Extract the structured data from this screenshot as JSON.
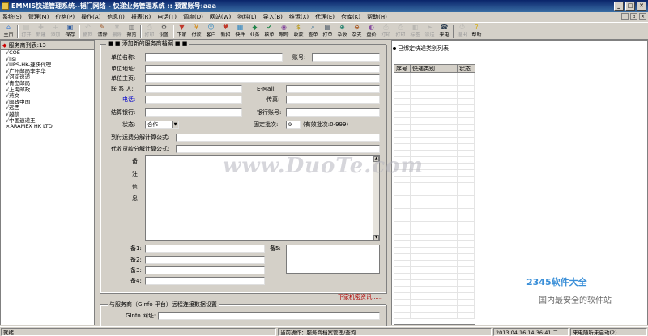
{
  "window": {
    "title": "EMMIS快递管理系统--韬门网络 - 快递业务管理系统 :: 预置账号:aaa",
    "buttons": [
      "_",
      "□",
      "✕"
    ]
  },
  "menu": [
    "系统(S)",
    "管理(M)",
    "价格(P)",
    "操作(A)",
    "信息(I)",
    "报表(R)",
    "电话(T)",
    "调度(D)",
    "网站(W)",
    "物料(L)",
    "导入(B)",
    "维运(X)",
    "代理(E)",
    "仓库(K)",
    "帮助(H)"
  ],
  "toolbar": [
    {
      "label": "主页",
      "icon": "home-icon",
      "glyph": "⌂",
      "color": "#3a7bd5",
      "enabled": true
    },
    {
      "label": "打开",
      "icon": "open-icon",
      "glyph": "▤",
      "color": "#999999",
      "enabled": false
    },
    {
      "label": "新建",
      "icon": "new-icon",
      "glyph": "✚",
      "color": "#999999",
      "enabled": false
    },
    {
      "label": "添加",
      "icon": "add-icon",
      "glyph": "+",
      "color": "#999999",
      "enabled": false
    },
    {
      "label": "保存",
      "icon": "save-icon",
      "glyph": "▣",
      "color": "#2c5aa0",
      "enabled": true
    },
    {
      "label": "撤回",
      "icon": "undo-icon",
      "glyph": "↶",
      "color": "#999999",
      "enabled": false
    },
    {
      "label": "清除",
      "icon": "clear-icon",
      "glyph": "✎",
      "color": "#a05a2c",
      "enabled": true
    },
    {
      "label": "删除",
      "icon": "delete-icon",
      "glyph": "✖",
      "color": "#999999",
      "enabled": false
    },
    {
      "label": "预览",
      "icon": "preview-icon",
      "glyph": "▥",
      "color": "#777777",
      "enabled": true
    },
    {
      "label": "打印",
      "icon": "print-icon",
      "glyph": "⎙",
      "color": "#999999",
      "enabled": false
    },
    {
      "label": "设置",
      "icon": "settings-icon",
      "glyph": "⚙",
      "color": "#555555",
      "enabled": true
    },
    {
      "label": "下家",
      "icon": "downline-icon",
      "glyph": "▼",
      "color": "#c0392b",
      "enabled": true
    },
    {
      "label": "付款",
      "icon": "payment-icon",
      "glyph": "¥",
      "color": "#d68910",
      "enabled": true
    },
    {
      "label": "客户",
      "icon": "customer-icon",
      "glyph": "☺",
      "color": "#2e86c1",
      "enabled": true
    },
    {
      "label": "新招",
      "icon": "recruit-icon",
      "glyph": "♥",
      "color": "#c0392b",
      "enabled": true
    },
    {
      "label": "快件",
      "icon": "parcel-icon",
      "glyph": "▦",
      "color": "#2e86c1",
      "enabled": true
    },
    {
      "label": "业务",
      "icon": "business-icon",
      "glyph": "◆",
      "color": "#1e8449",
      "enabled": true
    },
    {
      "label": "核单",
      "icon": "verify-icon",
      "glyph": "✔",
      "color": "#1e8449",
      "enabled": true
    },
    {
      "label": "跟踪",
      "icon": "track-icon",
      "glyph": "◉",
      "color": "#7d3c98",
      "enabled": true
    },
    {
      "label": "收款",
      "icon": "collect-icon",
      "glyph": "$",
      "color": "#b7950b",
      "enabled": true
    },
    {
      "label": "查单",
      "icon": "query-icon",
      "glyph": "⌕",
      "color": "#1f618d",
      "enabled": true
    },
    {
      "label": "打单",
      "icon": "printwaybill-icon",
      "glyph": "▤",
      "color": "#2e4053",
      "enabled": true
    },
    {
      "label": "杂收",
      "icon": "misc-income-icon",
      "glyph": "⊕",
      "color": "#117a65",
      "enabled": true
    },
    {
      "label": "杂支",
      "icon": "misc-expense-icon",
      "glyph": "⊖",
      "color": "#a04000",
      "enabled": true
    },
    {
      "label": "盘价",
      "icon": "pricing-icon",
      "glyph": "◐",
      "color": "#884ea0",
      "enabled": true
    },
    {
      "label": "打印",
      "icon": "print2-icon",
      "glyph": "⎙",
      "color": "#999999",
      "enabled": false
    },
    {
      "label": "打印",
      "icon": "print3-icon",
      "glyph": "⎙",
      "color": "#999999",
      "enabled": false
    },
    {
      "label": "标签",
      "icon": "label-icon",
      "glyph": "◧",
      "color": "#999999",
      "enabled": false
    },
    {
      "label": "派送",
      "icon": "dispatch-icon",
      "glyph": "➤",
      "color": "#999999",
      "enabled": false
    },
    {
      "label": "来电",
      "icon": "incoming-call-icon",
      "glyph": "☎",
      "color": "#2c3e50",
      "enabled": true
    },
    {
      "label": "退出",
      "icon": "exit-icon",
      "glyph": "⏻",
      "color": "#999999",
      "enabled": false
    },
    {
      "label": "帮助",
      "icon": "help-icon",
      "glyph": "?",
      "color": "#d4ac0d",
      "enabled": true
    }
  ],
  "left_panel": {
    "header": "服务商列表:13",
    "items": [
      "√COE",
      "√lisi",
      "√UPS-HK-速快代理",
      "√广州邮局李宇华",
      "√河间速递",
      "√青岛邮局",
      "√上海邮政",
      "√燕文",
      "√邮政中国",
      "√远西",
      "√越航",
      "√中国速递王",
      "×ARAMEX HK LTD"
    ]
  },
  "form": {
    "legend": "添加新的服务商档案",
    "unit_name_label": "单位名称:",
    "unit_name_value": "",
    "account_label": "账号:",
    "account_value": "",
    "address_label": "单位地址:",
    "address_value": "",
    "homepage_label": "单位主页:",
    "homepage_value": "",
    "contact_label": "联 系 人:",
    "contact_value": "",
    "email_label": "E-Mail:",
    "email_value": "",
    "phone_label": "电话:",
    "phone_value": "",
    "fax_label": "传真:",
    "fax_value": "",
    "bank_label": "结算银行:",
    "bank_value": "",
    "bank_account_label": "银行账号:",
    "bank_account_value": "",
    "status_label": "状态:",
    "status_value": "合作",
    "batch_label": "固定批次:",
    "batch_value": "9",
    "batch_hint": "(有效批次:0-999)",
    "freight_formula_label": "到付运费分解计算公式:",
    "freight_formula_value": "",
    "cod_formula_label": "代收货款分解计算公式:",
    "cod_formula_value": "",
    "remarks_label": [
      "备",
      "注",
      "信",
      "息"
    ],
    "memo1_label": "备1:",
    "memo2_label": "备2:",
    "memo3_label": "备3:",
    "memo4_label": "备4:",
    "memo5_label": "备5:",
    "download_link": "下家机密资讯......",
    "remote_legend": "与服务商（GInfo 平台）远程连接数据设置",
    "ginfo_url_label": "GInfo 网址:",
    "ginfo_url_value": ""
  },
  "right_panel": {
    "title": "已绑定快递类别列表",
    "columns": [
      "序号",
      "快递类别",
      "状态"
    ]
  },
  "status_bar": {
    "ready": "就绪",
    "current_op": "当前操作：服务商档案管理/查询",
    "datetime": "2013.04.16 14:36:41 二",
    "caller": "来电随听未启动(2)"
  },
  "watermarks": {
    "duote": "www.DuoTe.com",
    "brand": "2345软件大全",
    "slogan": "国内最安全的软件站"
  }
}
